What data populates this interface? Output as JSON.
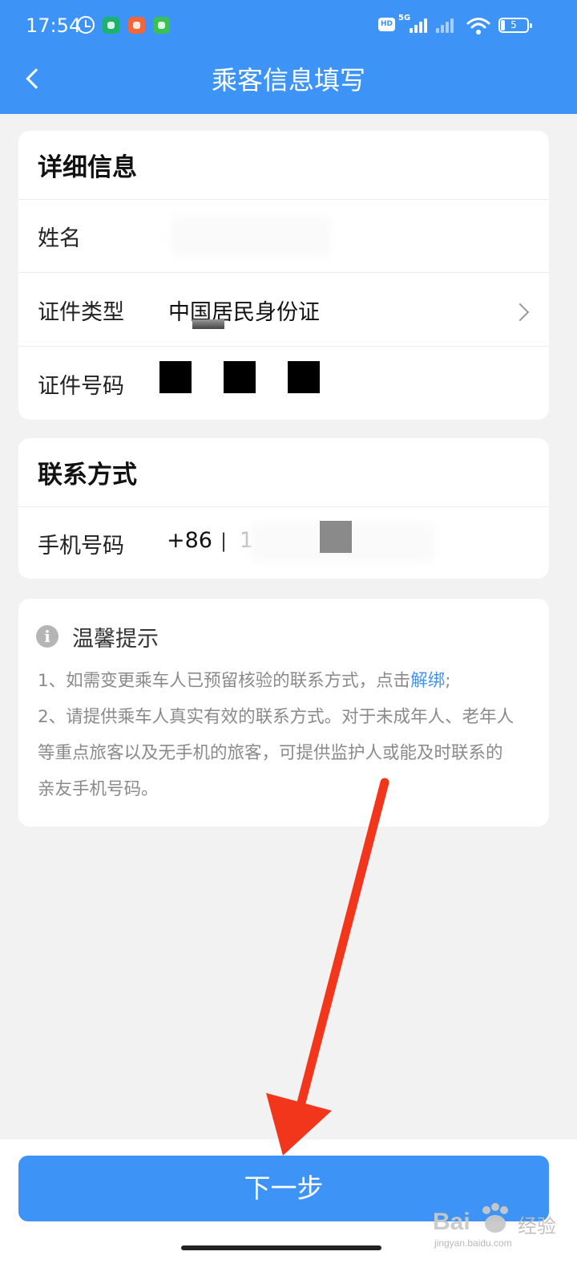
{
  "status_bar": {
    "time": "17:54",
    "network_hd": "HD",
    "network_type": "5G",
    "battery_level": "5"
  },
  "nav": {
    "title": "乘客信息填写"
  },
  "details_card": {
    "title": "详细信息",
    "name_label": "姓名",
    "id_type_label": "证件类型",
    "id_type_value": "中国居民身份证",
    "id_number_label": "证件号码"
  },
  "contact_card": {
    "title": "联系方式",
    "phone_label": "手机号码",
    "country_code": "+86",
    "separator": "|",
    "phone_partial": "1"
  },
  "tips_card": {
    "title": "温馨提示",
    "line1_prefix": "1、如需变更乘车人已预留核验的联系方式，点击",
    "line1_link": "解绑",
    "line1_suffix": ";",
    "line2": "2、请提供乘车人真实有效的联系方式。对于未成年人、老年人",
    "line3": "等重点旅客以及无手机的旅客，可提供监护人或能及时联系的",
    "line4": "亲友手机号码。"
  },
  "footer": {
    "next_label": "下一步"
  },
  "watermark": {
    "logo": "Bai",
    "text": "经验",
    "sub": "jingyan.baidu.com"
  },
  "colors": {
    "primary": "#3d94f6",
    "annotation_arrow": "#f2361c",
    "background": "#f2f2f2"
  }
}
